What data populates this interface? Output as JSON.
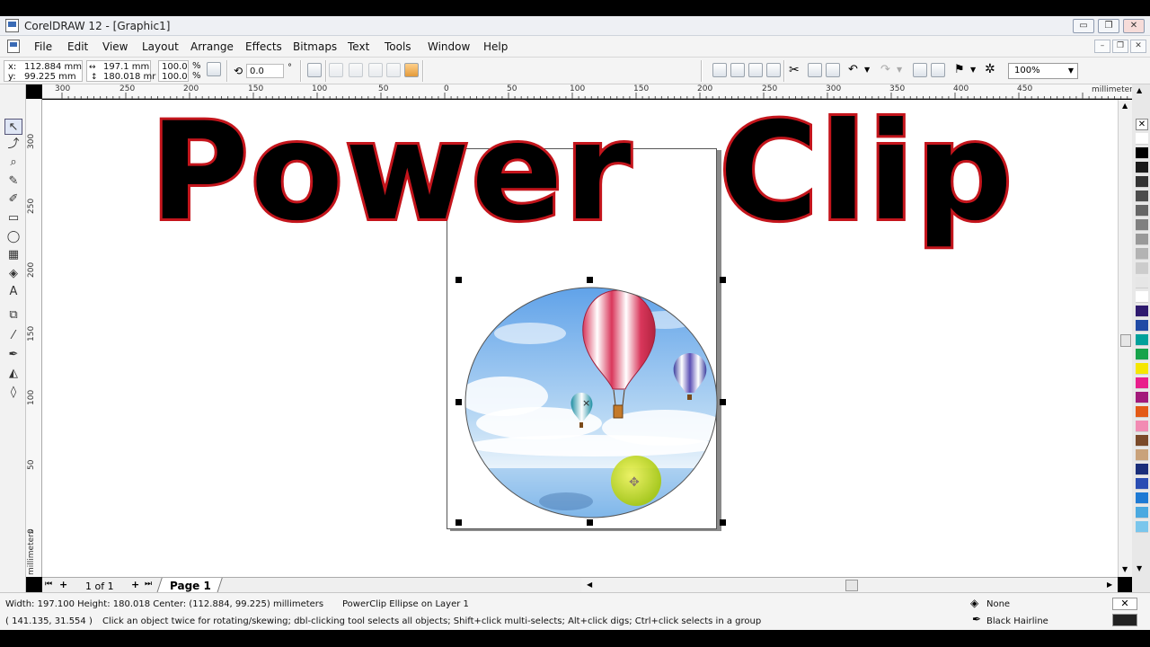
{
  "window": {
    "title": "CorelDRAW 12 - [Graphic1]",
    "controls": {
      "minimize": "▭",
      "restore": "❐",
      "close": "✕"
    },
    "mdi_controls": {
      "minimize": "–",
      "restore": "❐",
      "close": "✕"
    }
  },
  "menu": [
    "File",
    "Edit",
    "View",
    "Layout",
    "Arrange",
    "Effects",
    "Bitmaps",
    "Text",
    "Tools",
    "Window",
    "Help"
  ],
  "property_bar": {
    "x_label": "x:",
    "x_value": "112.884 mm",
    "y_label": "y:",
    "y_value": "99.225 mm",
    "width_value": "197.1 mm",
    "height_value": "180.018 mr",
    "scale_x": "100.0",
    "scale_y": "100.0",
    "percent": "%",
    "rotation": "0.0",
    "degree": "°",
    "zoom": "100%"
  },
  "ruler": {
    "h_ticks": [
      "300",
      "250",
      "200",
      "150",
      "100",
      "50",
      "0",
      "50",
      "100",
      "150",
      "200",
      "250",
      "300",
      "350",
      "400",
      "450"
    ],
    "v_ticks": [
      "300",
      "250",
      "200",
      "150",
      "100",
      "50",
      "0"
    ],
    "unit": "millimeters"
  },
  "canvas": {
    "heading": "PowerClip",
    "heading_words": [
      "Power",
      "Clip"
    ],
    "image_desc": "hot-air-balloons"
  },
  "page_nav": {
    "counter": "1 of 1",
    "tab": "Page 1"
  },
  "status": {
    "dimensions": "Width: 197.100  Height: 180.018  Center: (112.884, 99.225)  millimeters",
    "object": "PowerClip Ellipse on Layer 1",
    "cursor": "( 141.135, 31.554 )",
    "hint": "Click an object twice for rotating/skewing; dbl-clicking tool selects all objects; Shift+click multi-selects; Alt+click digs; Ctrl+click selects in a group",
    "fill": "None",
    "outline": "Black  Hairline"
  },
  "palette_colors": [
    "#ffffff",
    "#000000",
    "#1a1a1a",
    "#333333",
    "#4d4d4d",
    "#666666",
    "#808080",
    "#999999",
    "#b3b3b3",
    "#cccccc",
    "#e6e6e6",
    "#ffffff",
    "#2e1a6e",
    "#1f4aa5",
    "#00a19a",
    "#16a34a",
    "#f5e600",
    "#e91e8c",
    "#a21a7a",
    "#e35a16",
    "#f28bb3",
    "#7a4a2a",
    "#c9a27a",
    "#1a2e7a",
    "#2a4db3",
    "#1e7ad4",
    "#4aa9e0",
    "#7ac6ec"
  ]
}
